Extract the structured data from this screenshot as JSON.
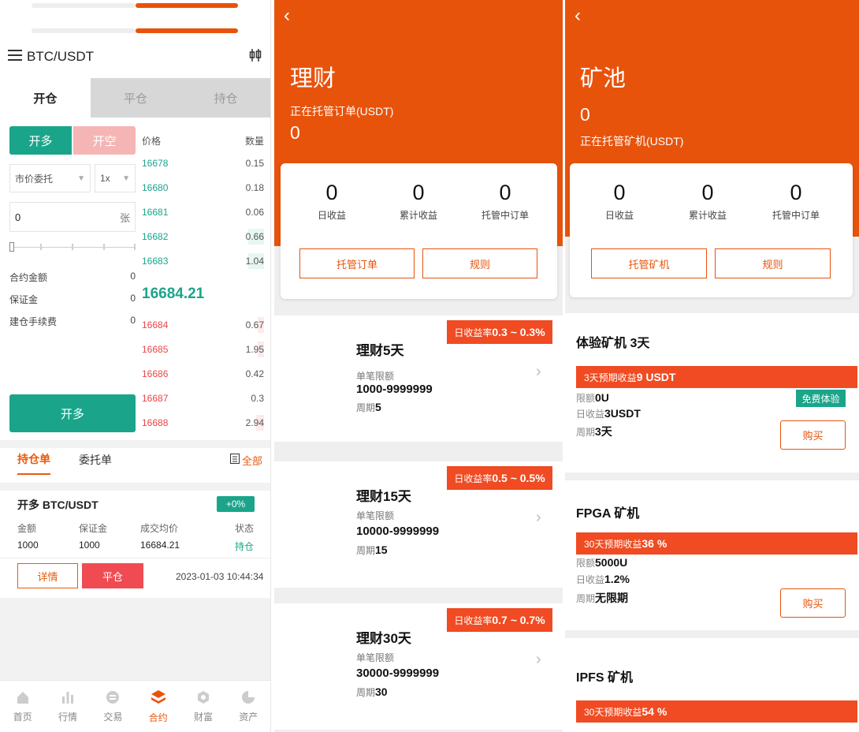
{
  "colors": {
    "accent": "#e8530c",
    "green": "#1aa58a",
    "red": "#e44444",
    "short_pink": "#f5b5b5"
  },
  "trade": {
    "pair": "BTC/USDT",
    "menu_icon": "hamburger-icon",
    "chart_icon": "candlestick-icon",
    "tabs": [
      "开仓",
      "平仓",
      "持仓"
    ],
    "long_label": "开多",
    "short_label": "开空",
    "order_type": "市价委托",
    "leverage": "1x",
    "amount_value": "0",
    "amount_unit": "张",
    "contract_amount_label": "合约金额",
    "contract_amount_value": "0",
    "margin_label": "保证金",
    "margin_value": "0",
    "fee_label": "建仓手续费",
    "fee_value": "0",
    "submit_label": "开多",
    "orderbook": {
      "price_header": "价格",
      "qty_header": "数量",
      "bids": [
        {
          "price": "16678",
          "qty": "0.15"
        },
        {
          "price": "16680",
          "qty": "0.18"
        },
        {
          "price": "16681",
          "qty": "0.06"
        },
        {
          "price": "16682",
          "qty": "0.66"
        },
        {
          "price": "16683",
          "qty": "1.04"
        }
      ],
      "last_price": "16684.21",
      "asks": [
        {
          "price": "16684",
          "qty": "0.67"
        },
        {
          "price": "16685",
          "qty": "1.95"
        },
        {
          "price": "16686",
          "qty": "0.42"
        },
        {
          "price": "16687",
          "qty": "0.3"
        },
        {
          "price": "16688",
          "qty": "2.94"
        }
      ]
    },
    "order_tabs": {
      "positions": "持仓单",
      "orders": "委托单",
      "all": "全部"
    },
    "position": {
      "title": "开多 BTC/USDT",
      "badge": "+0%",
      "headers": [
        "金额",
        "保证金",
        "成交均价",
        "状态"
      ],
      "values": [
        "1000",
        "1000",
        "16684.21",
        "持仓"
      ],
      "detail_label": "详情",
      "close_label": "平仓",
      "time": "2023-01-03 10:44:34"
    },
    "nav": [
      {
        "label": "首页",
        "icon": "home-icon"
      },
      {
        "label": "行情",
        "icon": "market-icon"
      },
      {
        "label": "交易",
        "icon": "trade-icon"
      },
      {
        "label": "合约",
        "icon": "contract-icon"
      },
      {
        "label": "财富",
        "icon": "wealth-icon"
      },
      {
        "label": "资产",
        "icon": "assets-icon"
      }
    ]
  },
  "wealth": {
    "back_icon": "back-icon",
    "title": "理财",
    "sub": "正在托管订单(USDT)",
    "total": "0",
    "stats": [
      {
        "value": "0",
        "label": "日收益"
      },
      {
        "value": "0",
        "label": "累计收益"
      },
      {
        "value": "0",
        "label": "托管中订单"
      }
    ],
    "btn_orders": "托管订单",
    "btn_rules": "规则",
    "plans": [
      {
        "name": "理财5天",
        "rate_prefix": "日收益率",
        "rate": "0.3 ~ 0.3%",
        "limit_label": "单笔限额",
        "limit": "1000-9999999",
        "period_label": "周期",
        "period": "5"
      },
      {
        "name": "理财15天",
        "rate_prefix": "日收益率",
        "rate": "0.5 ~ 0.5%",
        "limit_label": "单笔限额",
        "limit": "10000-9999999",
        "period_label": "周期",
        "period": "15"
      },
      {
        "name": "理财30天",
        "rate_prefix": "日收益率",
        "rate": "0.7 ~ 0.7%",
        "limit_label": "单笔限额",
        "limit": "30000-9999999",
        "period_label": "周期",
        "period": "30"
      }
    ]
  },
  "mining": {
    "back_icon": "back-icon",
    "title": "矿池",
    "total": "0",
    "sub": "正在托管矿机(USDT)",
    "stats": [
      {
        "value": "0",
        "label": "日收益"
      },
      {
        "value": "0",
        "label": "累计收益"
      },
      {
        "value": "0",
        "label": "托管中订单"
      }
    ],
    "btn_machines": "托管矿机",
    "btn_rules": "规则",
    "machines": [
      {
        "name": "体验矿机 3天",
        "bar_prefix": "3天预期收益",
        "bar_value": "9 USDT",
        "limit_label": "限额",
        "limit": "0U",
        "daily_label": "日收益",
        "daily": "3USDT",
        "period_label": "周期",
        "period": "3天",
        "free": "免费体验",
        "buy": "购买"
      },
      {
        "name": "FPGA 矿机",
        "bar_prefix": "30天预期收益",
        "bar_value": "36 %",
        "limit_label": "限额",
        "limit": "5000U",
        "daily_label": "日收益",
        "daily": "1.2%",
        "period_label": "周期",
        "period": "无限期",
        "buy": "购买"
      },
      {
        "name": "IPFS 矿机",
        "bar_prefix": "30天预期收益",
        "bar_value": "54 %"
      }
    ]
  }
}
